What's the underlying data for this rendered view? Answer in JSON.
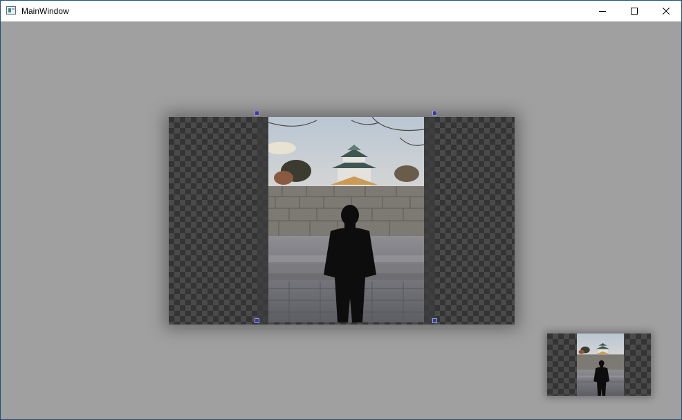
{
  "window": {
    "title": "MainWindow",
    "icon": "app-window-icon",
    "controls": {
      "minimize": "minimize-icon",
      "maximize": "maximize-icon",
      "close": "close-icon"
    }
  },
  "canvas": {
    "background": "#a0a0a0",
    "transparency_pattern": [
      "#343434",
      "#4a4a4a"
    ],
    "handle_color": "#3b3b9a"
  },
  "main_image": {
    "subject": "person-silhouette-in-front-of-castle-wall",
    "sky": "#c9d3dd",
    "wall": "#7d7a73",
    "ground": "#6e6f74"
  },
  "thumbnail": {
    "subject": "person-silhouette-in-front-of-castle-wall"
  }
}
